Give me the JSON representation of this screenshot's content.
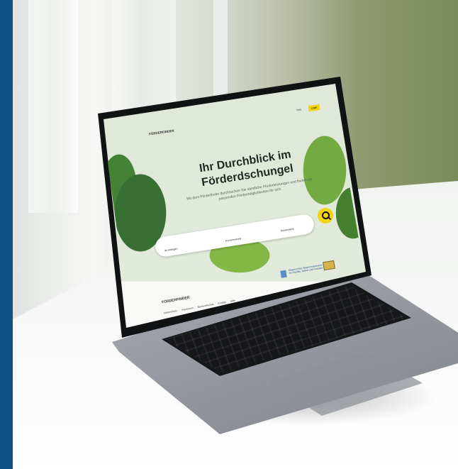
{
  "site": {
    "logo_text": "FÖRDERFINDER",
    "language": "Türk",
    "login_label": "Login"
  },
  "hero": {
    "title_line1": "Ihr Durchblick im",
    "title_line2": "Förderdschungel",
    "subtitle": "Mit dem Förderfinder durchsuchen Sie sämtliche Förderleistungen und finden die passenden Fördermöglichkeiten für sich."
  },
  "search": {
    "field1_label": "Ihr Anliegen",
    "field2_label": "Personenkreis",
    "field3_label": "Bundesland"
  },
  "footer": {
    "logo_text": "FÖRDERFINDER",
    "links": [
      "Datenschutz",
      "Impressum",
      "Barrierefreiheit",
      "Kontakt",
      "Hilfe"
    ],
    "ministry_text": "Bayerisches Staatsministerium für Familie, Arbeit und Soziales"
  },
  "icons": {
    "search": "search-icon",
    "coat_of_arms": "coat-of-arms-icon"
  },
  "colors": {
    "accent_yellow": "#f2d310",
    "sidebar_blue": "#0d4f86",
    "hero_bg": "#e2eadc",
    "keyboard": "#161719"
  }
}
